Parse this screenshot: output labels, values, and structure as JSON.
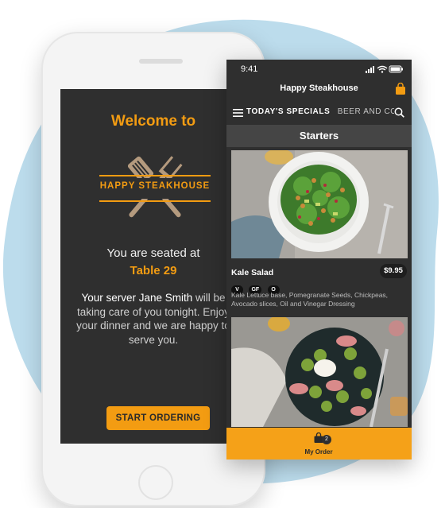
{
  "colors": {
    "accent": "#f39c12",
    "screen_bg": "#2f2f2f",
    "blob": "#bcdcec"
  },
  "welcome_screen": {
    "heading": "Welcome to",
    "restaurant_logo_text": "HAPPY STEAKHOUSE",
    "seated_text": "You are seated at",
    "table": "Table 29",
    "server_text_name": "Your server Jane Smith",
    "server_text_rest": "will be taking care of you tonight. Enjoy your dinner and we are happy to serve you.",
    "start_button": "START ORDERING"
  },
  "menu_screen": {
    "status_time": "9:41",
    "title": "Happy Steakhouse",
    "tabs": [
      {
        "label": "TODAY'S SPECIALS",
        "active": true
      },
      {
        "label": "BEER AND COCKTAILS",
        "active": false
      }
    ],
    "section": "Starters",
    "items": [
      {
        "name": "Kale Salad",
        "price": "$9.95",
        "tags": [
          "V",
          "GF",
          "O"
        ],
        "description": "Kale Lettuce base, Pomegranate Seeds, Chickpeas, Avocado slices, Oil and Vinegar Dressing"
      }
    ],
    "order_bar": {
      "label": "My Order",
      "count": "2"
    }
  }
}
